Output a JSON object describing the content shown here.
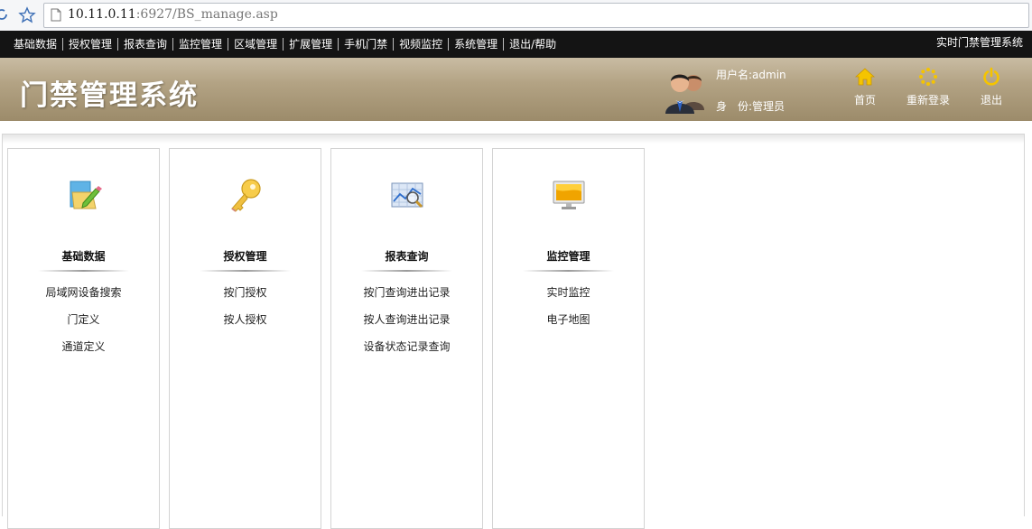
{
  "browser": {
    "url_host": "10.11.0.11",
    "url_rest": ":6927/BS_manage.asp"
  },
  "menubar": {
    "items": [
      "基础数据",
      "授权管理",
      "报表查询",
      "监控管理",
      "区域管理",
      "扩展管理",
      "手机门禁",
      "视频监控",
      "系统管理",
      "退出/帮助"
    ],
    "system_link": "实时门禁管理系统"
  },
  "header": {
    "title": "门禁管理系统",
    "user_name": "用户名:admin",
    "user_role": "身　份:管理员",
    "buttons": {
      "home": "首页",
      "relogin": "重新登录",
      "exit": "退出"
    }
  },
  "panels": [
    {
      "title": "基础数据",
      "icon": "folder-pencil-icon",
      "links": [
        "局域网设备搜索",
        "门定义",
        "通道定义"
      ]
    },
    {
      "title": "授权管理",
      "icon": "key-icon",
      "links": [
        "按门授权",
        "按人授权"
      ]
    },
    {
      "title": "报表查询",
      "icon": "chart-search-icon",
      "links": [
        "按门查询进出记录",
        "按人查询进出记录",
        "设备状态记录查询"
      ]
    },
    {
      "title": "监控管理",
      "icon": "monitor-icon",
      "links": [
        "实时监控",
        "电子地图"
      ]
    }
  ],
  "colors": {
    "menubar_bg": "#141414",
    "header_bg": "#b3a384",
    "icon_gold": "#f2b600"
  }
}
